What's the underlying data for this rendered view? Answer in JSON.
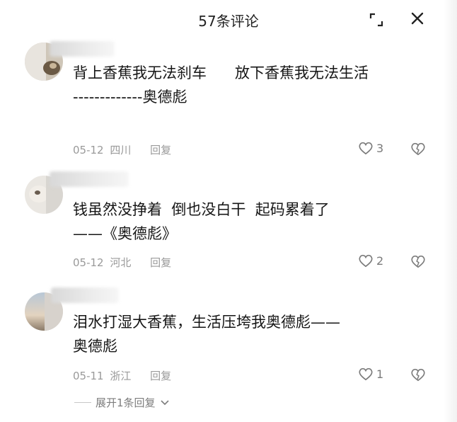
{
  "header": {
    "title": "57条评论"
  },
  "comments": [
    {
      "text": "背上香蕉我无法刹车      放下香蕉我无法生活\n-------------奥德彪",
      "date": "05-12",
      "location": "四川",
      "reply_label": "回复",
      "likes": "3"
    },
    {
      "text": "钱虽然没挣着  倒也没白干  起码累着了\n——《奥德彪》",
      "date": "05-12",
      "location": "河北",
      "reply_label": "回复",
      "likes": "2"
    },
    {
      "text": "泪水打湿大香蕉，生活压垮我奥德彪——\n奥德彪",
      "date": "05-11",
      "location": "浙江",
      "reply_label": "回复",
      "likes": "1"
    }
  ],
  "expand_replies": {
    "label": "展开1条回复"
  },
  "icons": {
    "expand": "expand-icon",
    "close": "close-icon",
    "like": "heart-icon",
    "dislike": "broken-heart-icon",
    "chevron": "chevron-down-icon"
  },
  "colors": {
    "meta": "#9a9a9a",
    "text": "#161616"
  }
}
